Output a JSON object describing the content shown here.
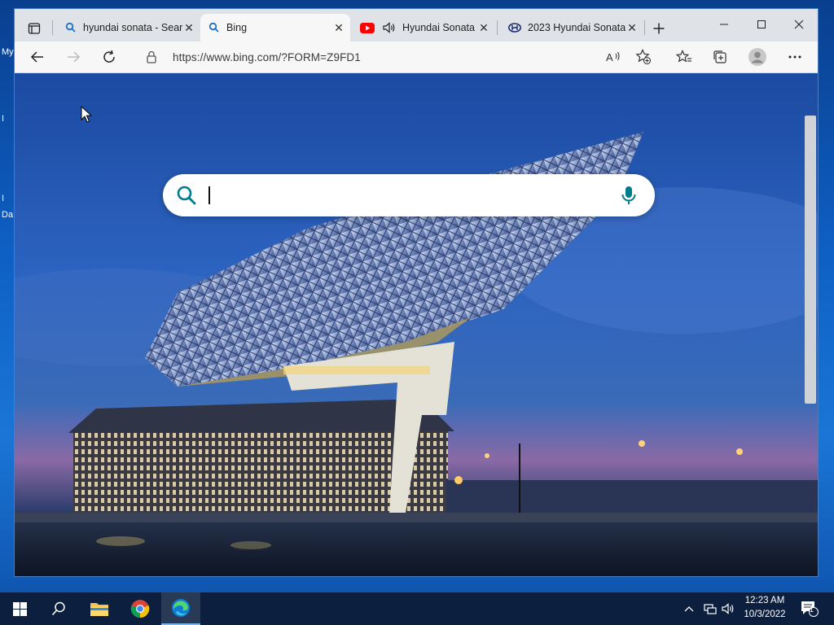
{
  "desktop": {
    "icon_labels": [
      "My",
      "I",
      "I",
      "Da"
    ]
  },
  "tabs": [
    {
      "title": "hyundai sonata - Sear",
      "icon": "bing-search-icon",
      "active": false
    },
    {
      "title": "Bing",
      "icon": "bing-search-icon",
      "active": true
    },
    {
      "title": "Hyundai Sonata",
      "icon": "youtube-icon",
      "active": false,
      "audio": true
    },
    {
      "title": "2023 Hyundai Sonata",
      "icon": "hyundai-logo-icon",
      "active": false
    }
  ],
  "address_bar": {
    "url": "https://www.bing.com/?FORM=Z9FD1"
  },
  "search": {
    "value": "",
    "placeholder": ""
  },
  "taskbar": {
    "time": "12:23 AM",
    "date": "10/3/2022",
    "notification_count": "1"
  },
  "colors": {
    "bing_teal": "#007c8f",
    "youtube_red": "#ff0000",
    "taskbar_bg": "#0c1f3f"
  }
}
